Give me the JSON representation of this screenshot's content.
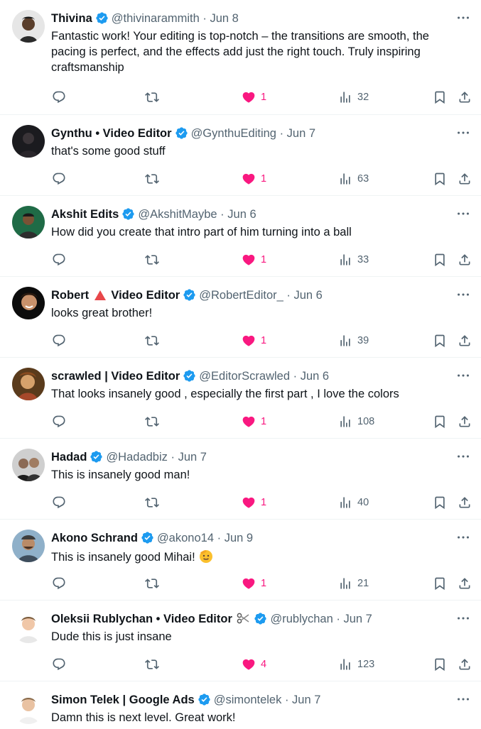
{
  "colors": {
    "like": "#f91880",
    "verified": "#1d9bf0",
    "secondary_text": "#536471",
    "primary_text": "#0f1419"
  },
  "tweets": [
    {
      "name": "Thivina",
      "handle": "@thivinarammith",
      "separator": "·",
      "date": "Jun 8",
      "text": "Fantastic work! Your editing is top-notch – the transitions are smooth, the pacing is perfect, and the effects add just the right touch. Truly inspiring craftsmanship",
      "likes": "1",
      "views": "32",
      "avatar_icon": "avatar-photo"
    },
    {
      "name": "Gynthu • Video Editor",
      "handle": "@GynthuEditing",
      "separator": "·",
      "date": "Jun 7",
      "text": "that's some good stuff",
      "likes": "1",
      "views": "63",
      "avatar_icon": "avatar-photo"
    },
    {
      "name": "Akshit Edits",
      "handle": "@AkshitMaybe",
      "separator": "·",
      "date": "Jun 6",
      "text": "How did you create that intro part of him turning into a ball",
      "likes": "1",
      "views": "33",
      "avatar_icon": "avatar-photo"
    },
    {
      "name_part1": "Robert",
      "name_part2": "Video Editor",
      "name_emoji": "red-triangle-icon",
      "handle": "@RobertEditor_",
      "separator": "·",
      "date": "Jun 6",
      "text": "looks great brother!",
      "likes": "1",
      "views": "39",
      "avatar_icon": "avatar-photo"
    },
    {
      "name": "scrawled | Video Editor",
      "handle": "@EditorScrawled",
      "separator": "·",
      "date": "Jun 6",
      "text": "That looks insanely good , especially the first part , I love the colors",
      "likes": "1",
      "views": "108",
      "avatar_icon": "avatar-painting"
    },
    {
      "name": "Hadad",
      "handle": "@Hadadbiz",
      "separator": "·",
      "date": "Jun 7",
      "text": "This is insanely good man!",
      "likes": "1",
      "views": "40",
      "avatar_icon": "avatar-photo"
    },
    {
      "name": "Akono Schrand",
      "handle": "@akono14",
      "separator": "·",
      "date": "Jun 9",
      "text": "This is insanely good Mihai!",
      "text_emoji": "saluting-face-icon",
      "likes": "1",
      "views": "21",
      "avatar_icon": "avatar-photo"
    },
    {
      "name": "Oleksii Rublychan • Video Editor",
      "name_emoji": "scissors-icon",
      "handle": "@rublychan",
      "separator": "·",
      "date": "Jun 7",
      "text": "Dude this is just insane",
      "likes": "4",
      "views": "123",
      "avatar_icon": "avatar-photo"
    },
    {
      "name": "Simon Telek | Google Ads",
      "handle": "@simontelek",
      "separator": "·",
      "date": "Jun 7",
      "text": "Damn this is next level. Great work!",
      "avatar_icon": "avatar-photo"
    }
  ]
}
